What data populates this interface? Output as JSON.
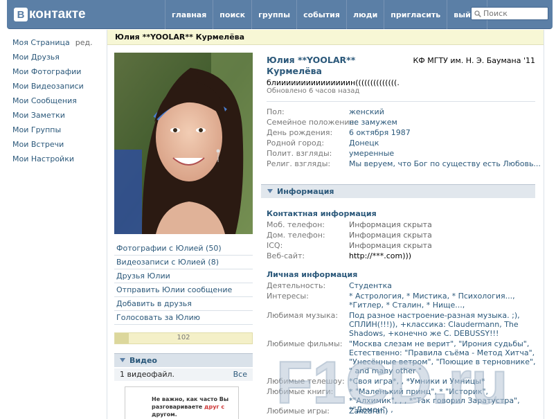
{
  "header": {
    "logo_letter": "В",
    "logo_text": "контакте",
    "nav": [
      "главная",
      "поиск",
      "группы",
      "события",
      "люди",
      "пригласить",
      "выйти"
    ],
    "search_placeholder": "Поиск"
  },
  "leftmenu": {
    "items": [
      "Моя Страница",
      "Мои Друзья",
      "Мои Фотографии",
      "Мои Видеозаписи",
      "Мои Сообщения",
      "Мои Заметки",
      "Мои Группы",
      "Мои Встречи",
      "Мои Настройки"
    ],
    "edit_label": "ред."
  },
  "profile": {
    "title": "Юлия **YOOLAR** Курмелёва",
    "name_line1": "Юлия **YOOLAR**",
    "name_line2": "Курмелёва",
    "university": "КФ МГТУ им. Н. Э. Баумана '11",
    "status": "блииииииииииииииин((((((((((((((.",
    "updated": "Обновлено 6 часов назад",
    "basic": [
      {
        "label": "Пол:",
        "value": "женский"
      },
      {
        "label": "Семейное положение:",
        "value": "не замужем"
      },
      {
        "label": "День рождения:",
        "value": "6 октября 1987"
      },
      {
        "label": "Родной город:",
        "value": "Донецк"
      },
      {
        "label": "Полит. взгляды:",
        "value": "умеренные"
      },
      {
        "label": "Религ. взгляды:",
        "value": "Мы веруем, что Бог по существу есть Любовь..."
      }
    ],
    "info_header": "Информация",
    "contact_title": "Контактная информация",
    "contact": [
      {
        "label": "Моб. телефон:",
        "value": "Информация скрыта"
      },
      {
        "label": "Дом. телефон:",
        "value": "Информация скрыта"
      },
      {
        "label": "ICQ:",
        "value": "Информация скрыта"
      },
      {
        "label": "Веб-сайт:",
        "value": "http://***.com)))"
      }
    ],
    "personal_title": "Личная информация",
    "personal": [
      {
        "label": "Деятельность:",
        "value": "Студентка"
      },
      {
        "label": "Интересы:",
        "value": "* Астрология, * Мистика, * Психология..., *Гитлер, * Сталин, * Нище...,"
      },
      {
        "label": "Любимая музыка:",
        "value": "Под разное настроение-разная музыка. ;), СПЛИН(!!!)), +классика: Claudermann, The Shadows, +конечно же C. DEBUSSY!!!"
      },
      {
        "label": "Любимые фильмы:",
        "value": "\"Москва слезам не верит\", \"Ирония судьбы\", Естественно: \"Правила съёма - Метод Хитча\", \"Унесённые ветром\", \"Поющие в терновнике\", \" and many other \""
      },
      {
        "label": "Любимые телешоу:",
        "value": "*Своя игра*, , *Умники и Умницы*"
      },
      {
        "label": "Любимые книги:",
        "value": "* \"Маленький принц\", * \"Историк\", *\"Алхимик\", , , *\"Так говорил Заратустра\", *\"Демон\", ,"
      },
      {
        "label": "Любимые игры:",
        "value": "Zanzarah)"
      }
    ]
  },
  "left_links": [
    "Фотографии с Юлией (50)",
    "Видеозаписи с Юлией (8)",
    "Друзья Юлии",
    "Отправить Юлии сообщение",
    "Добавить в друзья",
    "Голосовать за Юлию"
  ],
  "rating": {
    "value": "102",
    "fraction": 0.1
  },
  "video": {
    "header": "Видео",
    "count": "1 видеофайл.",
    "all": "Все",
    "thumb_line1": "Не важно, как часто Вы",
    "thumb_line2": "разговариваете",
    "thumb_red": "друг с",
    "thumb_line3": "другом."
  },
  "watermark": "F1CD.ru"
}
